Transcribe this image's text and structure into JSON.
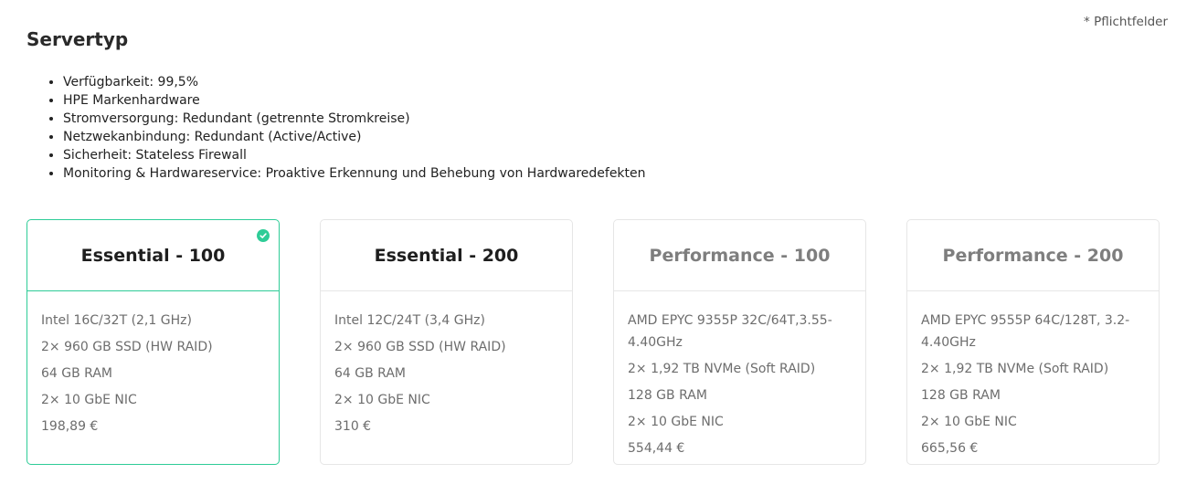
{
  "header": {
    "title": "Servertyp",
    "required_note": "* Pflichtfelder"
  },
  "features": [
    "Verfügbarkeit: 99,5%",
    "HPE Markenhardware",
    "Stromversorgung: Redundant (getrennte Stromkreise)",
    "Netzwekanbindung: Redundant (Active/Active)",
    "Sicherheit: Stateless Firewall",
    "Monitoring & Hardwareservice: Proaktive Erkennung und Behebung von Hardwaredefekten"
  ],
  "colors": {
    "accent": "#2ecc97",
    "muted_title": "#7e7e7e"
  },
  "cards": [
    {
      "title": "Essential - 100",
      "selected": true,
      "specs": [
        "Intel 16C/32T (2,1 GHz)",
        "2× 960 GB SSD (HW RAID)",
        "64 GB RAM",
        "2× 10 GbE NIC"
      ],
      "price": "198,89 €"
    },
    {
      "title": "Essential - 200",
      "selected": false,
      "specs": [
        "Intel 12C/24T (3,4 GHz)",
        "2× 960 GB SSD (HW RAID)",
        "64 GB RAM",
        "2× 10 GbE NIC"
      ],
      "price": "310 €"
    },
    {
      "title": "Performance - 100",
      "selected": false,
      "specs": [
        "AMD EPYC 9355P 32C/64T,3.55-4.40GHz",
        "2× 1,92 TB NVMe (Soft RAID)",
        "128 GB RAM",
        "2× 10 GbE NIC"
      ],
      "price": "554,44 €"
    },
    {
      "title": "Performance - 200",
      "selected": false,
      "specs": [
        "AMD EPYC 9555P 64C/128T, 3.2-4.40GHz",
        "2× 1,92 TB NVMe (Soft RAID)",
        "128 GB RAM",
        "2× 10 GbE NIC"
      ],
      "price": "665,56 €"
    }
  ]
}
